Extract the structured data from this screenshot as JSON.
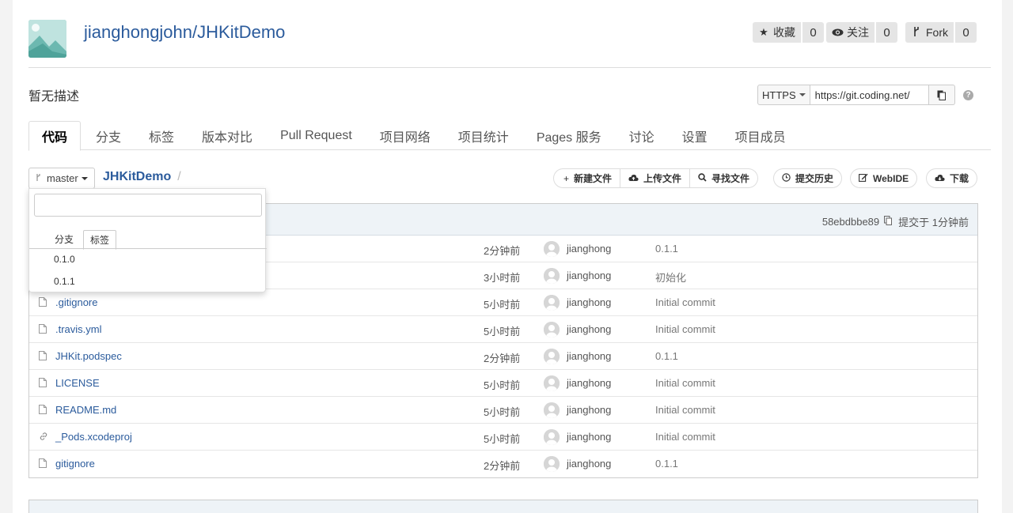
{
  "repo": {
    "title": "jianghongjohn/JHKitDemo",
    "description": "暂无描述"
  },
  "stats": [
    {
      "label": "收藏",
      "count": "0",
      "icon": "star-icon"
    },
    {
      "label": "关注",
      "count": "0",
      "icon": "eye-icon"
    },
    {
      "label": "Fork",
      "count": "0",
      "icon": "fork-icon"
    }
  ],
  "clone": {
    "protocol": "HTTPS",
    "url": "https://git.coding.net/"
  },
  "help_label": "?",
  "tabs": [
    {
      "label": "代码",
      "active": true
    },
    {
      "label": "分支"
    },
    {
      "label": "标签"
    },
    {
      "label": "版本对比"
    },
    {
      "label": "Pull Request"
    },
    {
      "label": "项目网络"
    },
    {
      "label": "项目统计"
    },
    {
      "label": "Pages 服务"
    },
    {
      "label": "讨论"
    },
    {
      "label": "设置"
    },
    {
      "label": "项目成员"
    }
  ],
  "branch": {
    "current": "master"
  },
  "breadcrumb": {
    "root": "JHKitDemo",
    "separator": "/"
  },
  "actions": {
    "new_file": "新建文件",
    "upload_file": "上传文件",
    "find_file": "寻找文件",
    "history": "提交历史",
    "webide": "WebIDE",
    "download": "下载"
  },
  "latest_commit": {
    "hash": "58ebdbbe89",
    "time": "提交于 1分钟前"
  },
  "dropdown": {
    "search_placeholder": "",
    "tabs": [
      "分支",
      "标签"
    ],
    "active_tab": "标签",
    "items": [
      "0.1.0",
      "0.1.1"
    ]
  },
  "files": [
    {
      "name": "",
      "time": "2分钟前",
      "user": "jianghong",
      "message": "0.1.1",
      "type": "file"
    },
    {
      "name": "",
      "time": "3小时前",
      "user": "jianghong",
      "message": "初始化",
      "type": "file"
    },
    {
      "name": ".gitignore",
      "time": "5小时前",
      "user": "jianghong",
      "message": "Initial commit",
      "type": "file"
    },
    {
      "name": ".travis.yml",
      "time": "5小时前",
      "user": "jianghong",
      "message": "Initial commit",
      "type": "file"
    },
    {
      "name": "JHKit.podspec",
      "time": "2分钟前",
      "user": "jianghong",
      "message": "0.1.1",
      "type": "file"
    },
    {
      "name": "LICENSE",
      "time": "5小时前",
      "user": "jianghong",
      "message": "Initial commit",
      "type": "file"
    },
    {
      "name": "README.md",
      "time": "5小时前",
      "user": "jianghong",
      "message": "Initial commit",
      "type": "file"
    },
    {
      "name": "_Pods.xcodeproj",
      "time": "5小时前",
      "user": "jianghong",
      "message": "Initial commit",
      "type": "link"
    },
    {
      "name": "gitignore",
      "time": "2分钟前",
      "user": "jianghong",
      "message": "0.1.1",
      "type": "file"
    }
  ]
}
